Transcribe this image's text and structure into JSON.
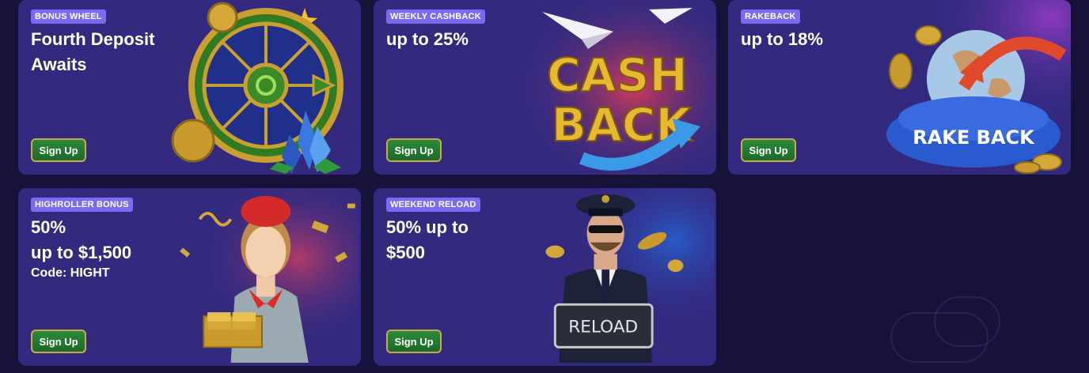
{
  "cards": [
    {
      "badge": "BONUS WHEEL",
      "lines": [
        "Fourth Deposit",
        "Awaits"
      ],
      "button": "Sign Up"
    },
    {
      "badge": "WEEKLY CASHBACK",
      "lines": [
        "up to 25%"
      ],
      "button": "Sign Up",
      "art_text": [
        "CASH",
        "BACK"
      ]
    },
    {
      "badge": "RAKEBACK",
      "lines": [
        "up to 18%"
      ],
      "button": "Sign Up",
      "art_text": [
        "RAKE BACK"
      ]
    },
    {
      "badge": "HIGHROLLER BONUS",
      "lines": [
        "50%",
        "up to $1,500"
      ],
      "sub": "Code: HIGHT",
      "button": "Sign Up"
    },
    {
      "badge": "WEEKEND RELOAD",
      "lines": [
        "50% up to",
        "$500"
      ],
      "button": "Sign Up",
      "art_text": [
        "RELOAD"
      ]
    }
  ],
  "colors": {
    "page_bg": "#16123a",
    "card_bg": "#332a80",
    "badge_bg": "#7a6cf0",
    "button_green": "#2c8a3a",
    "button_border": "#c9a94a"
  }
}
